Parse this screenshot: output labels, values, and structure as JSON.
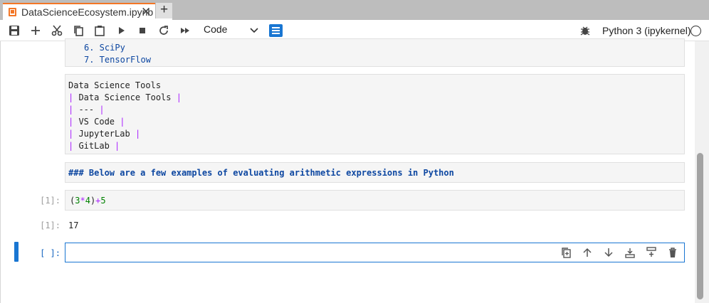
{
  "tab": {
    "title": "DataScienceEcosystem.ipynb",
    "close": "✕",
    "new": "+"
  },
  "toolbar": {
    "cell_type": "Code",
    "kernel": "Python 3 (ipykernel)"
  },
  "cells": {
    "list_lines": [
      "6. SciPy",
      "7. TensorFlow"
    ],
    "tools_heading": "Data Science Tools",
    "tools_rows": [
      {
        "p1": "|",
        "text": " Data Science Tools ",
        "p2": "|"
      },
      {
        "p1": "|",
        "text": " --- ",
        "p2": "|"
      },
      {
        "p1": "|",
        "text": " VS Code ",
        "p2": "|"
      },
      {
        "p1": "|",
        "text": " JupyterLab ",
        "p2": "|"
      },
      {
        "p1": "|",
        "text": " GitLab ",
        "p2": "|"
      }
    ],
    "markdown_heading": "### Below are a few examples of evaluating arithmetic expressions in Python",
    "code": {
      "open": "(",
      "a": "3",
      "times": "*",
      "b": "4",
      "close": ")",
      "plus": "+",
      "c": "5"
    },
    "in_prompt": "[1]:",
    "out_prompt": "[1]:",
    "output": "17",
    "empty_prompt": "[ ]:"
  },
  "colors": {
    "accent": "#1976d2",
    "tab_accent": "#f37626"
  }
}
